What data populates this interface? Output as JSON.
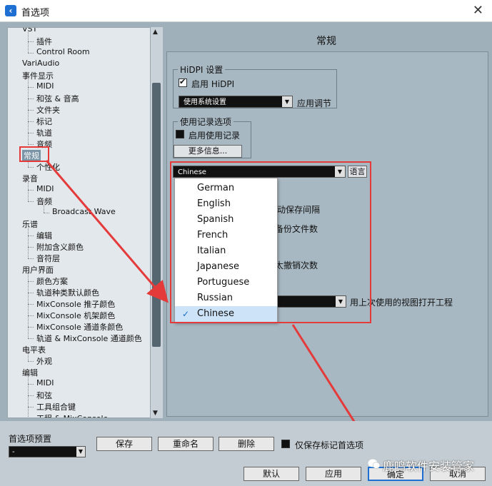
{
  "window": {
    "title": "首选项"
  },
  "tree": {
    "items": [
      {
        "label": "VST",
        "level": 0
      },
      {
        "label": "插件",
        "level": 1
      },
      {
        "label": "Control Room",
        "level": 1
      },
      {
        "label": "VariAudio",
        "level": 0
      },
      {
        "label": "事件显示",
        "level": 0
      },
      {
        "label": "MIDI",
        "level": 1
      },
      {
        "label": "和弦 & 音高",
        "level": 1
      },
      {
        "label": "文件夹",
        "level": 1
      },
      {
        "label": "标记",
        "level": 1
      },
      {
        "label": "轨道",
        "level": 1
      },
      {
        "label": "音频",
        "level": 1
      },
      {
        "label": "常规",
        "level": 0
      },
      {
        "label": "个性化",
        "level": 1
      },
      {
        "label": "录音",
        "level": 0
      },
      {
        "label": "MIDI",
        "level": 1
      },
      {
        "label": "音频",
        "level": 1
      },
      {
        "label": "Broadcast Wave",
        "level": 2
      },
      {
        "label": "乐谱",
        "level": 0
      },
      {
        "label": "编辑",
        "level": 1
      },
      {
        "label": "附加含义颜色",
        "level": 1
      },
      {
        "label": "音符层",
        "level": 1
      },
      {
        "label": "用户界面",
        "level": 0
      },
      {
        "label": "颜色方案",
        "level": 1
      },
      {
        "label": "轨道种类默认颜色",
        "level": 1
      },
      {
        "label": "MixConsole 推子颜色",
        "level": 1
      },
      {
        "label": "MixConsole 机架颜色",
        "level": 1
      },
      {
        "label": "MixConsole 通道条颜色",
        "level": 1
      },
      {
        "label": "轨道 & MixConsole 通道颜色",
        "level": 1
      },
      {
        "label": "电平表",
        "level": 0
      },
      {
        "label": "外观",
        "level": 1
      },
      {
        "label": "编辑",
        "level": 0
      },
      {
        "label": "MIDI",
        "level": 1
      },
      {
        "label": "和弦",
        "level": 1
      },
      {
        "label": "工具组合键",
        "level": 1
      },
      {
        "label": "工程 & MixConsole",
        "level": 1
      }
    ]
  },
  "main": {
    "section_title": "常规",
    "hidpi": {
      "group_label": "HiDPI 设置",
      "enable_label": "启用 HiDPI",
      "dropdown_value": "使用系统设置",
      "side_label": "应用调节"
    },
    "usage": {
      "group_label": "使用记录选项",
      "enable_label": "启用使用记录",
      "more_info": "更多信息..."
    },
    "language": {
      "selected": "Chinese",
      "button": "语言"
    },
    "partial": {
      "autosave": "动保存间隔",
      "backup": "备份文件数",
      "undo": "太撤销次数",
      "open_project": "用上次使用的视图打开工程"
    },
    "language_menu": [
      "German",
      "English",
      "Spanish",
      "French",
      "Italian",
      "Japanese",
      "Portuguese",
      "Russian",
      "Chinese"
    ]
  },
  "bottom": {
    "preset_label": "首选项预置",
    "preset_value": "-",
    "save": "保存",
    "rename": "重命名",
    "delete": "删除",
    "only_marked": "仅保存标记首选项",
    "default": "默认",
    "apply": "应用",
    "ok": "确定",
    "cancel": "取消"
  },
  "watermark": {
    "text": "鹿鸣软件安装管家"
  }
}
